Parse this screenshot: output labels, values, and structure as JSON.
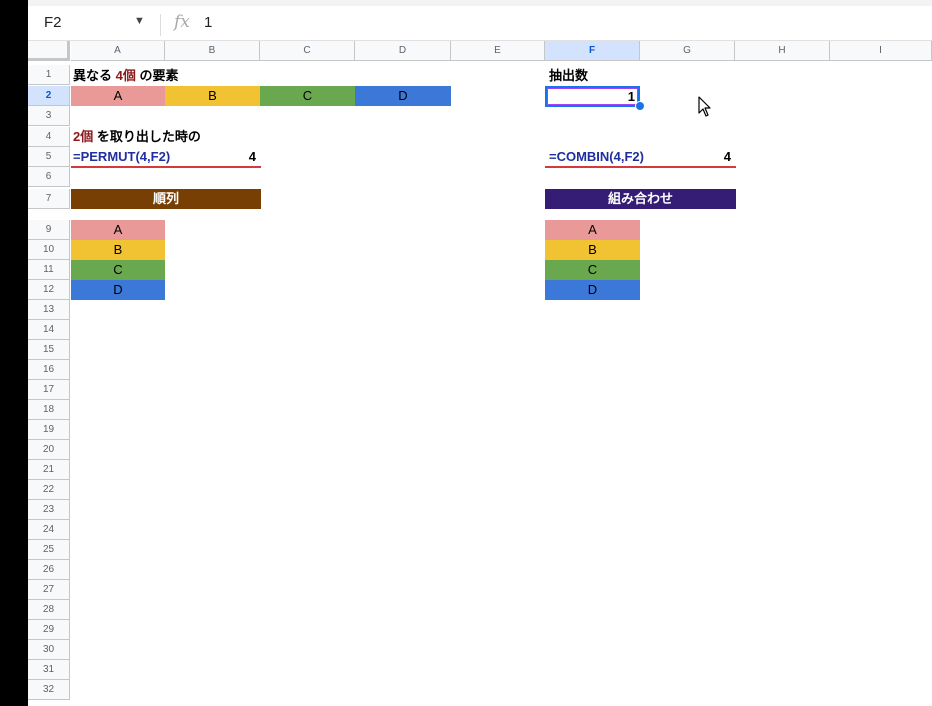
{
  "formula_bar": {
    "name_box": "F2",
    "fx_icon": "fx",
    "value": "1"
  },
  "columns": [
    "A",
    "B",
    "C",
    "D",
    "E",
    "F",
    "G",
    "H",
    "I"
  ],
  "selected_column": "F",
  "rows": [
    "1",
    "2",
    "3",
    "4",
    "5",
    "6",
    "7",
    "9",
    "10",
    "11",
    "12",
    "13",
    "14",
    "15",
    "16",
    "17",
    "18",
    "19",
    "20",
    "21",
    "22",
    "23",
    "24",
    "25",
    "26",
    "27",
    "28",
    "29",
    "30",
    "31",
    "32"
  ],
  "selected_row": "2",
  "cells": {
    "a1_prefix": "異なる ",
    "a1_count": "4個",
    "a1_suffix": " の要素",
    "row2": [
      "A",
      "B",
      "C",
      "D"
    ],
    "a4_count": "2個",
    "a4_suffix": " を取り出した時の",
    "a5_formula": "=PERMUT(4,F2)",
    "b5_result": "4",
    "a7_header": "順列",
    "a_list": [
      "A",
      "B",
      "C",
      "D"
    ],
    "f1_label": "抽出数",
    "f2_value": "1",
    "f5_formula": "=COMBIN(4,F2)",
    "g5_result": "4",
    "f7_header": "組み合わせ",
    "f_list": [
      "A",
      "B",
      "C",
      "D"
    ]
  },
  "colors": {
    "pink": "#ea9999",
    "yellow": "#f1c232",
    "green": "#6aa84f",
    "blue": "#3c78d8",
    "brown": "#783f04",
    "purple": "#351c75",
    "selection": "#1a73e8"
  }
}
